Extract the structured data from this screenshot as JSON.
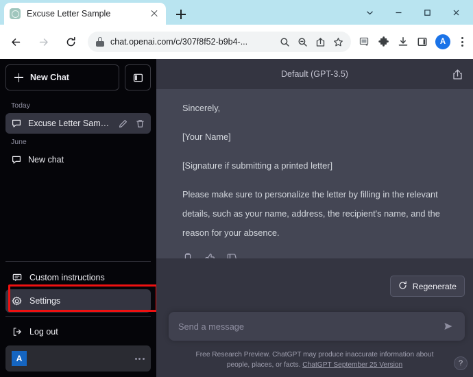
{
  "browser": {
    "tab": {
      "title": "Excuse Letter Sample",
      "favicon": "chatgpt-favicon",
      "close": "close-tab-icon"
    },
    "new_tab_label": "new-tab-icon",
    "window_controls": [
      "chevron-down-icon",
      "minimize-icon",
      "maximize-icon",
      "close-icon"
    ],
    "toolbar": {
      "back": "back-arrow-icon",
      "forward": "forward-arrow-icon",
      "reload": "reload-icon",
      "lock": "lock-icon",
      "url": "chat.openai.com/c/307f8f52-b9b4-...",
      "omnibox_icons": [
        "search-icon",
        "zoom-out-icon",
        "share-icon",
        "bookmark-star-icon"
      ],
      "toolbar_icons": [
        "media-cast-icon",
        "extensions-puzzle-icon",
        "downloads-icon",
        "side-panel-icon"
      ],
      "profile_initial": "A",
      "menu": "kebab-menu-icon"
    }
  },
  "sidebar": {
    "new_chat_label": "New Chat",
    "toggle_icon": "sidebar-toggle-icon",
    "groups": [
      {
        "label": "Today",
        "items": [
          {
            "title": "Excuse Letter Sample",
            "active": true,
            "edit": "edit-pencil-icon",
            "delete": "trash-icon"
          }
        ]
      },
      {
        "label": "June",
        "items": [
          {
            "title": "New chat",
            "active": false
          }
        ]
      }
    ],
    "menu_items": [
      {
        "label": "Custom instructions",
        "icon": "speech-bubble-icon",
        "selected": false
      },
      {
        "label": "Settings",
        "icon": "gear-icon",
        "selected": true
      },
      {
        "label": "Log out",
        "icon": "logout-icon",
        "selected": false
      }
    ],
    "profile": {
      "initial": "A",
      "more": "ellipsis-icon"
    },
    "highlight_color": "#ee1111"
  },
  "main": {
    "model_label": "Default (GPT-3.5)",
    "share_icon": "share-upload-icon",
    "message": {
      "paragraphs": [
        "Sincerely,",
        "[Your Name]",
        "[Signature if submitting a printed letter]",
        "Please make sure to personalize the letter by filling in the relevant details, such as your name, address, the recipient's name, and the reason for your absence."
      ],
      "actions": [
        "copy-icon",
        "thumbs-up-icon",
        "thumbs-down-icon"
      ]
    },
    "regenerate_label": "Regenerate",
    "regenerate_icon": "refresh-icon",
    "composer": {
      "placeholder": "Send a message",
      "send_icon": "send-arrow-icon"
    },
    "footer": {
      "text": "Free Research Preview. ChatGPT may produce inaccurate information about people, places, or facts.",
      "link": "ChatGPT September 25 Version"
    },
    "help_label": "?"
  }
}
